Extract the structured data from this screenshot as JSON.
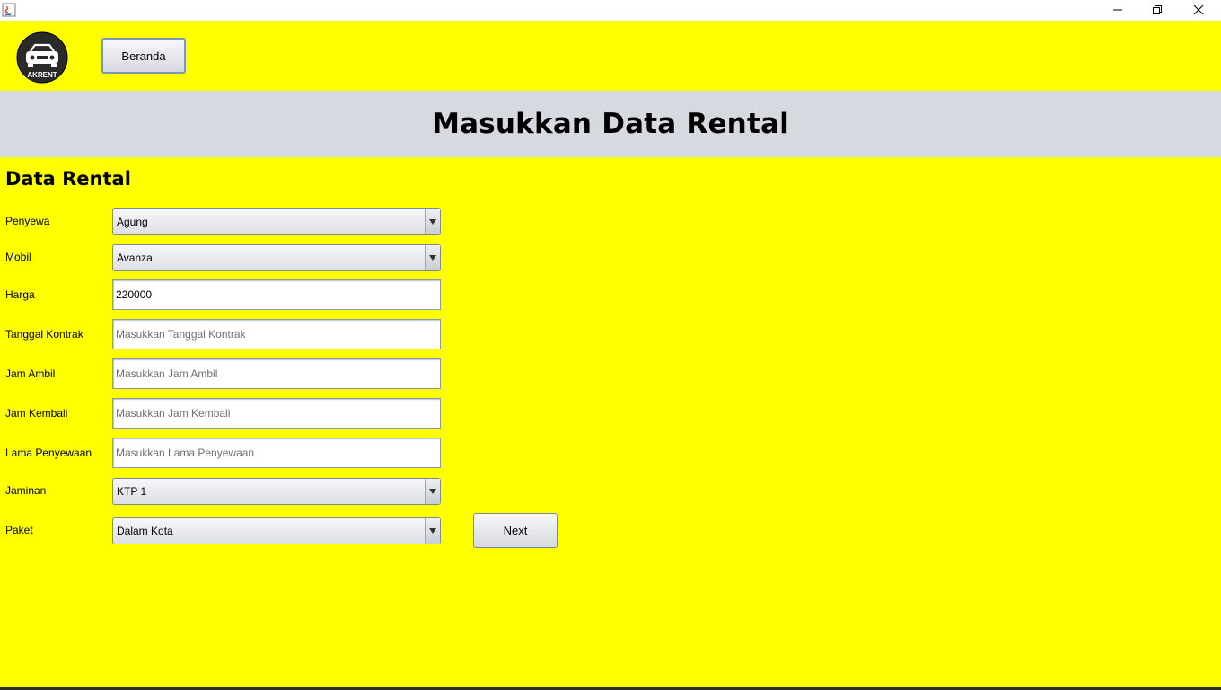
{
  "window": {
    "minimize_icon": "minimize-icon",
    "maximize_icon": "restore-icon",
    "close_icon": "close-icon"
  },
  "header": {
    "logo_text": "AKRENT",
    "dot": ".",
    "beranda_label": "Beranda"
  },
  "banner": {
    "title": "Masukkan Data Rental"
  },
  "section": {
    "title": "Data Rental"
  },
  "form": {
    "penyewa": {
      "label": "Penyewa",
      "value": "Agung"
    },
    "mobil": {
      "label": "Mobil",
      "value": "Avanza"
    },
    "harga": {
      "label": "Harga",
      "value": "220000",
      "placeholder": ""
    },
    "tanggal_kontrak": {
      "label": "Tanggal Kontrak",
      "value": "",
      "placeholder": "Masukkan Tanggal Kontrak"
    },
    "jam_ambil": {
      "label": "Jam Ambil",
      "value": "",
      "placeholder": "Masukkan Jam Ambil"
    },
    "jam_kembali": {
      "label": "Jam Kembali",
      "value": "",
      "placeholder": "Masukkan Jam Kembali"
    },
    "lama_penyewaan": {
      "label": "Lama Penyewaan",
      "value": "",
      "placeholder": "Masukkan Lama Penyewaan"
    },
    "jaminan": {
      "label": "Jaminan",
      "value": "KTP 1"
    },
    "paket": {
      "label": "Paket",
      "value": "Dalam Kota"
    }
  },
  "actions": {
    "next_label": "Next"
  },
  "colors": {
    "background": "#ffff00",
    "banner": "#d6d9df"
  }
}
